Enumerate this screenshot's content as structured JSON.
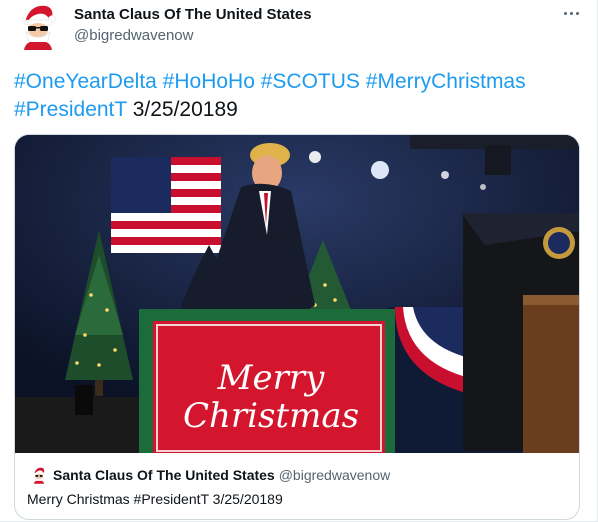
{
  "tweet": {
    "author": {
      "name": "Santa Claus Of The United States",
      "handle": "@bigredwavenow",
      "avatar_icon": "santa-avatar-icon"
    },
    "more_icon": "more-options-icon",
    "text": {
      "hashtags_line1": [
        "#OneYearDelta",
        "#HoHoHo",
        "#SCOTUS",
        "#MerryChristmas"
      ],
      "hashtag_line2": "#PresidentT",
      "date_text": "3/25/20189"
    },
    "media": {
      "sign_line1": "Merry",
      "sign_line2": "Christmas"
    },
    "quote": {
      "author_name": "Santa Claus Of The United States",
      "author_handle": "@bigredwavenow",
      "text": "Merry Christmas #PresidentT 3/25/20189"
    }
  },
  "colors": {
    "link": "#1d9bf0",
    "text_primary": "#0f1419",
    "text_secondary": "#536471",
    "border": "#cfd9de",
    "sign_red": "#d3162d",
    "sign_green": "#1c6b3a"
  }
}
